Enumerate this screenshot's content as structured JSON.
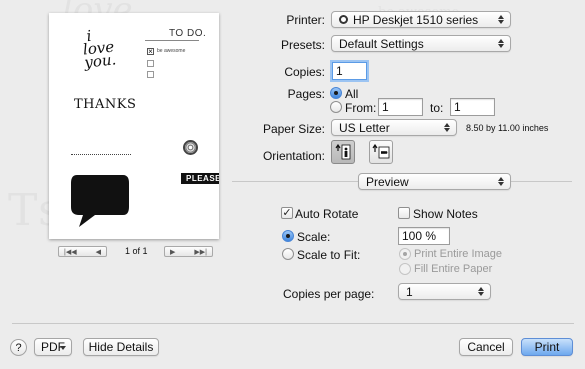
{
  "watermark": {
    "left": "love",
    "right_small": "be awesome",
    "right_big": "Ts  GS"
  },
  "preview": {
    "big_love": [
      "i",
      "love",
      "you."
    ],
    "todo_title": "TO DO.",
    "todo_item": "be awesome",
    "thanks": "THANKS",
    "please": "PLEASE?",
    "page_indicator": "1 of 1"
  },
  "form": {
    "printer_label": "Printer:",
    "printer_value": "HP Deskjet 1510 series",
    "presets_label": "Presets:",
    "presets_value": "Default Settings",
    "copies_label": "Copies:",
    "copies_value": "1",
    "pages_label": "Pages:",
    "pages_all": "All",
    "pages_from": "From:",
    "pages_from_value": "1",
    "pages_to": "to:",
    "pages_to_value": "1",
    "paper_label": "Paper Size:",
    "paper_value": "US Letter",
    "paper_dims": "8.50 by 11.00 inches",
    "orientation_label": "Orientation:",
    "section_value": "Preview",
    "auto_rotate": "Auto Rotate",
    "show_notes": "Show Notes",
    "scale_label": "Scale:",
    "scale_value": "100 %",
    "scale_fit": "Scale to Fit:",
    "print_entire": "Print Entire Image",
    "fill_entire": "Fill Entire Paper",
    "copies_per_page_label": "Copies per page:",
    "copies_per_page_value": "1"
  },
  "footer": {
    "help": "?",
    "pdf": "PDF",
    "hide_details": "Hide Details",
    "cancel": "Cancel",
    "print": "Print"
  }
}
